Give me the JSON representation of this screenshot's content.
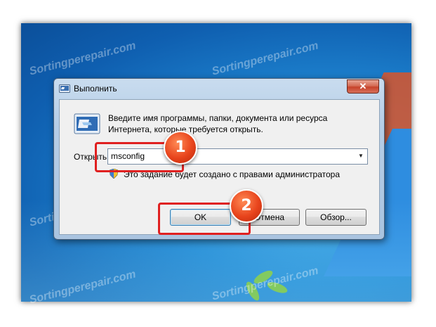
{
  "desktop": {
    "watermark_text": "Sortingperepair.com"
  },
  "dialog": {
    "title": "Выполнить",
    "close_glyph": "✕",
    "description": "Введите имя программы, папки, документа или ресурса Интернета, которые требуется открыть.",
    "open_label": "Открыть:",
    "open_value": "msconfig",
    "admin_note": "Это задание будет создано с правами администратора",
    "buttons": {
      "ok": "OK",
      "cancel": "Отмена",
      "browse": "Обзор..."
    },
    "icons": {
      "title": "run-app-icon",
      "main": "run-program-icon",
      "admin": "uac-shield-icon",
      "dropdown": "chevron-down-icon"
    }
  },
  "annotations": {
    "step1": "1",
    "step2": "2",
    "highlight_color": "#e02020",
    "badge_color": "#e8441c"
  }
}
